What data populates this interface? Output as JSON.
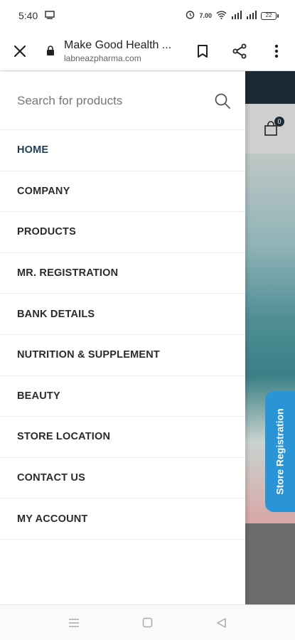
{
  "status_bar": {
    "time": "5:40",
    "battery": "22",
    "icons": [
      "monitor-icon",
      "alarm-icon",
      "network-speed-icon",
      "wifi-icon",
      "signal-icon",
      "signal-icon",
      "battery-icon"
    ],
    "net_speed": "7.00"
  },
  "browser": {
    "title": "Make Good Health ...",
    "domain": "labneazpharma.com",
    "icons": {
      "close": "close-icon",
      "lock": "lock-icon",
      "bookmark": "bookmark-icon",
      "share": "share-icon",
      "menu": "more-vert-icon"
    }
  },
  "search": {
    "placeholder": "Search for products",
    "icon": "search-icon"
  },
  "menu": {
    "items": [
      {
        "label": "HOME",
        "active": true
      },
      {
        "label": "COMPANY"
      },
      {
        "label": "PRODUCTS"
      },
      {
        "label": "MR. REGISTRATION"
      },
      {
        "label": "BANK DETAILS"
      },
      {
        "label": "NUTRITION & SUPPLEMENT"
      },
      {
        "label": "BEAUTY"
      },
      {
        "label": "STORE LOCATION"
      },
      {
        "label": "CONTACT US"
      },
      {
        "label": "MY ACCOUNT"
      }
    ]
  },
  "site": {
    "cart_count": "0",
    "store_registration": "Store Registration"
  },
  "colors": {
    "accent": "#2a95d6",
    "active_menu": "#1d3d5c",
    "site_header": "#1c2a36"
  },
  "nav_bar": {
    "icons": [
      "recents-icon",
      "home-icon",
      "back-icon"
    ]
  }
}
